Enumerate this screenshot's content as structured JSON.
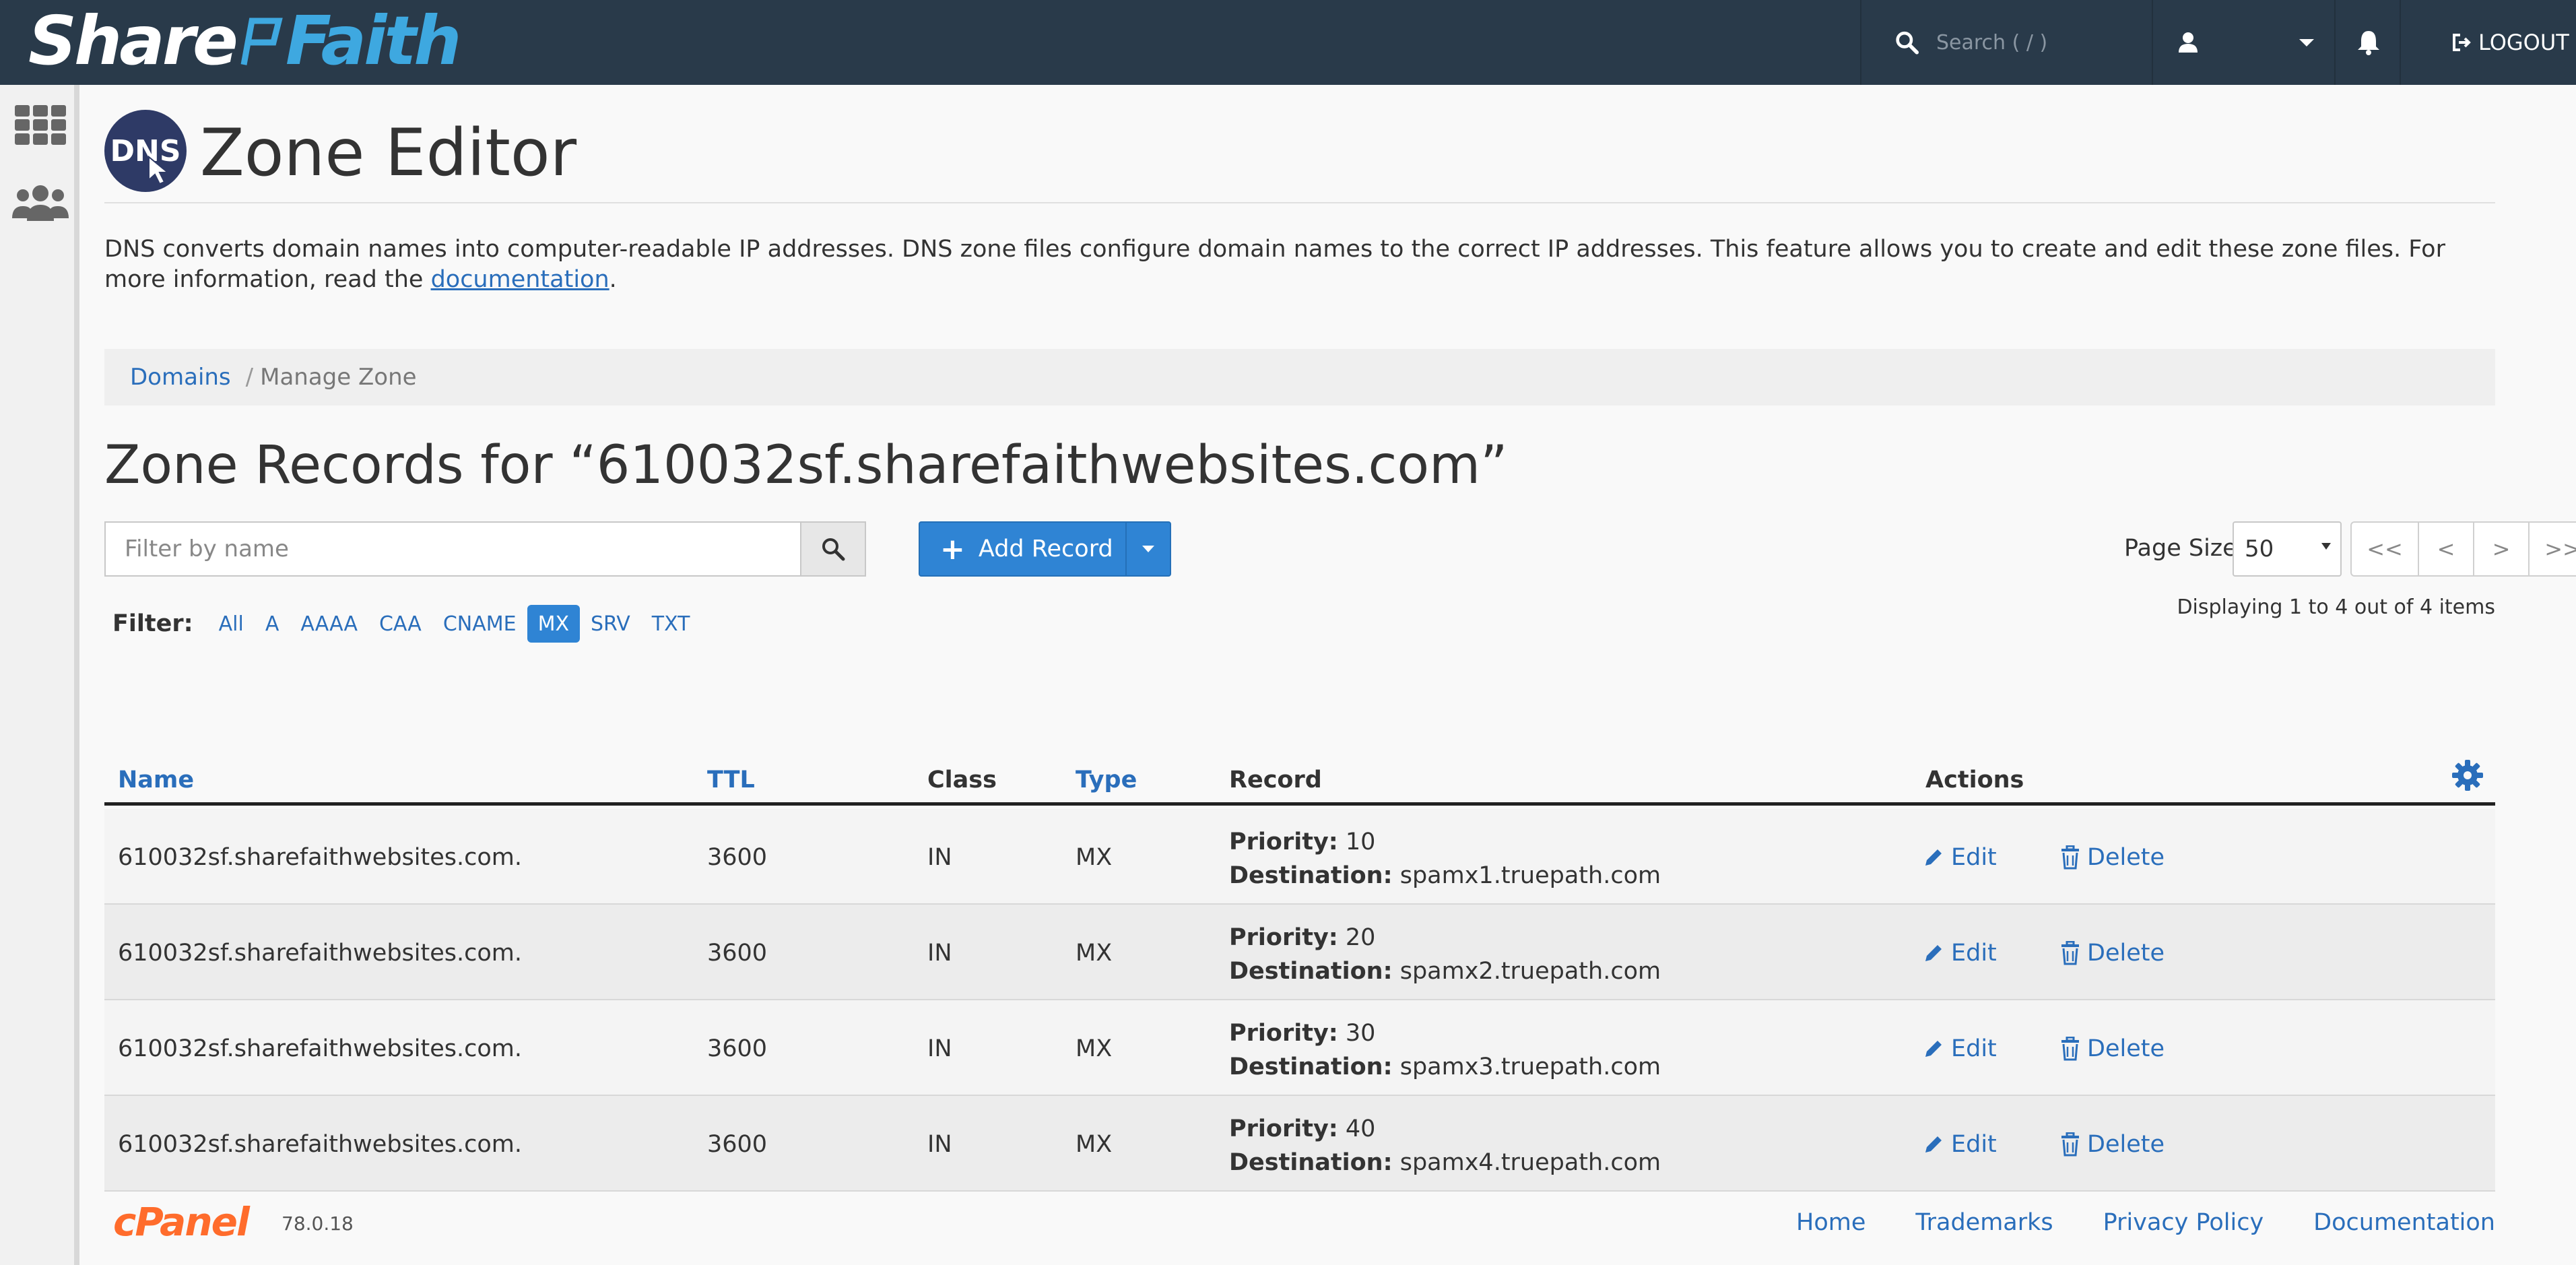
{
  "brand": {
    "part1": "Share",
    "part2": "Faith"
  },
  "topbar": {
    "search_placeholder": "Search ( / )",
    "logout_label": "LOGOUT"
  },
  "page": {
    "title": "Zone Editor",
    "dns_logo_text": "DNS",
    "description": "DNS converts domain names into computer-readable IP addresses. DNS zone files configure domain names to the correct IP addresses. This feature allows you to create and edit these zone files. For more information, read the ",
    "doc_link": "documentation",
    "description_end": "."
  },
  "breadcrumb": {
    "domains": "Domains",
    "separator": "/",
    "current": "Manage Zone"
  },
  "records_title": "Zone Records for “610032sf.sharefaithwebsites.com”",
  "toolbar": {
    "filter_placeholder": "Filter by name",
    "add_record_label": "Add Record",
    "page_size_label": "Page Size",
    "page_size_value": "50",
    "pager": [
      "<<",
      "<",
      ">",
      ">>"
    ],
    "displaying": "Displaying 1 to 4 out of 4 items"
  },
  "filter": {
    "label": "Filter:",
    "options": [
      "All",
      "A",
      "AAAA",
      "CAA",
      "CNAME",
      "MX",
      "SRV",
      "TXT"
    ],
    "active": "MX"
  },
  "table": {
    "headers": {
      "name": "Name",
      "ttl": "TTL",
      "class": "Class",
      "type": "Type",
      "record": "Record",
      "actions": "Actions"
    },
    "priority_label": "Priority:",
    "destination_label": "Destination:",
    "edit_label": "Edit",
    "delete_label": "Delete",
    "rows": [
      {
        "name": "610032sf.sharefaithwebsites.com.",
        "ttl": "3600",
        "class": "IN",
        "type": "MX",
        "priority": "10",
        "destination": "spamx1.truepath.com"
      },
      {
        "name": "610032sf.sharefaithwebsites.com.",
        "ttl": "3600",
        "class": "IN",
        "type": "MX",
        "priority": "20",
        "destination": "spamx2.truepath.com"
      },
      {
        "name": "610032sf.sharefaithwebsites.com.",
        "ttl": "3600",
        "class": "IN",
        "type": "MX",
        "priority": "30",
        "destination": "spamx3.truepath.com"
      },
      {
        "name": "610032sf.sharefaithwebsites.com.",
        "ttl": "3600",
        "class": "IN",
        "type": "MX",
        "priority": "40",
        "destination": "spamx4.truepath.com"
      }
    ]
  },
  "footer": {
    "logo": "cPanel",
    "version": "78.0.18",
    "links": [
      "Home",
      "Trademarks",
      "Privacy Policy",
      "Documentation"
    ]
  },
  "colors": {
    "topbar": "#293a4a",
    "accent": "#2f84d4",
    "link": "#2a6ebb",
    "brand_faith": "#3ea8e0",
    "cpanel": "#ff6c2c"
  }
}
